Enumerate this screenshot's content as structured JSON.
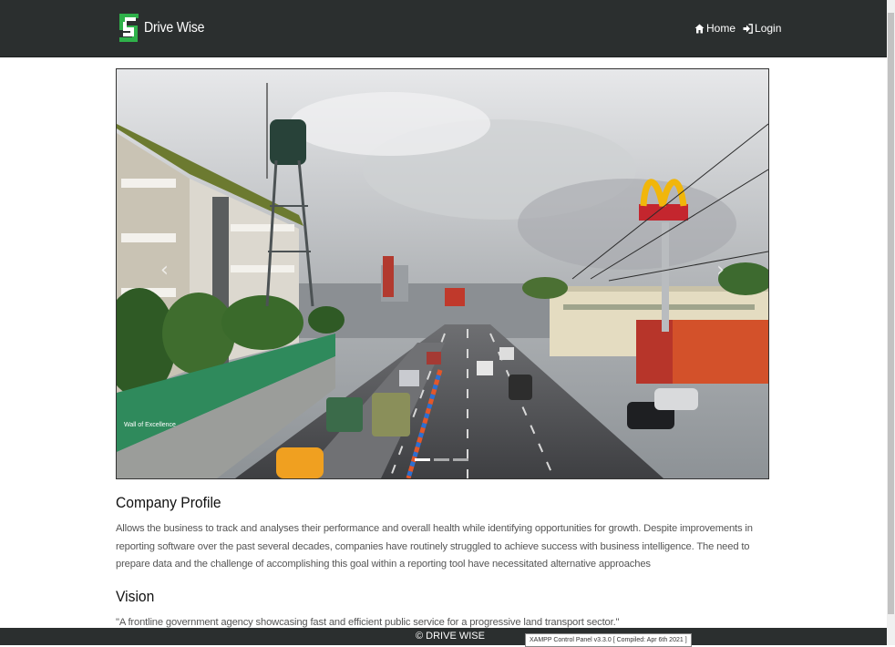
{
  "brand": {
    "name": "Drive Wise"
  },
  "nav": {
    "home_label": "Home",
    "login_label": "Login"
  },
  "carousel": {
    "prev_symbol": "‹",
    "next_symbol": "›",
    "slide_count": 3,
    "active_index": 0,
    "sign_text": "Wall of Excellence"
  },
  "profile": {
    "title": "Company Profile",
    "text": "Allows the business to track and analyses their performance and overall health while identifying opportunities for growth. Despite improvements in reporting software over the past several decades, companies have routinely struggled to achieve success with business intelligence. The need to prepare data and the challenge of accomplishing this goal within a reporting tool have necessitated alternative approaches"
  },
  "vision": {
    "title": "Vision",
    "text": "\"A frontline government agency showcasing fast and efficient public service for a progressive land transport sector.\""
  },
  "footer": {
    "text": "© DRIVE WISE"
  },
  "tooltip": {
    "text": "XAMPP Control Panel v3.3.0   [ Compiled: Apr 6th 2021 ]"
  },
  "colors": {
    "navbar": "#2b2f2f",
    "logo_green": "#2fb14a",
    "text_muted": "#555555"
  },
  "icons": [
    "logo-icon",
    "home-icon",
    "login-icon"
  ]
}
